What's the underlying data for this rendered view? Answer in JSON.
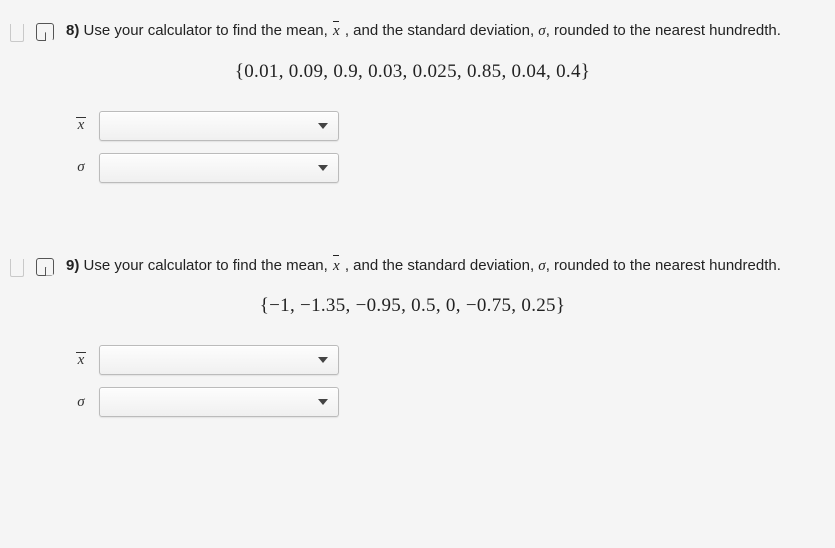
{
  "questions": [
    {
      "number": "8)",
      "prompt_before_xbar": "Use your calculator to find the mean, ",
      "prompt_mid": " , and the standard deviation, ",
      "sigma": "σ",
      "prompt_after": ", rounded to the nearest hundredth.",
      "dataset": "{0.01, 0.09, 0.9, 0.03, 0.025, 0.85, 0.04, 0.4}",
      "rows": [
        {
          "symbol": "x",
          "is_xbar": true,
          "value": ""
        },
        {
          "symbol": "σ",
          "is_xbar": false,
          "value": ""
        }
      ]
    },
    {
      "number": "9)",
      "prompt_before_xbar": "Use your calculator to find the mean, ",
      "prompt_mid": " , and the standard deviation, ",
      "sigma": "σ",
      "prompt_after": ", rounded to the nearest hundredth.",
      "dataset": "{−1, −1.35, −0.95, 0.5, 0, −0.75, 0.25}",
      "rows": [
        {
          "symbol": "x",
          "is_xbar": true,
          "value": ""
        },
        {
          "symbol": "σ",
          "is_xbar": false,
          "value": ""
        }
      ]
    }
  ],
  "xbar_glyph": "x"
}
